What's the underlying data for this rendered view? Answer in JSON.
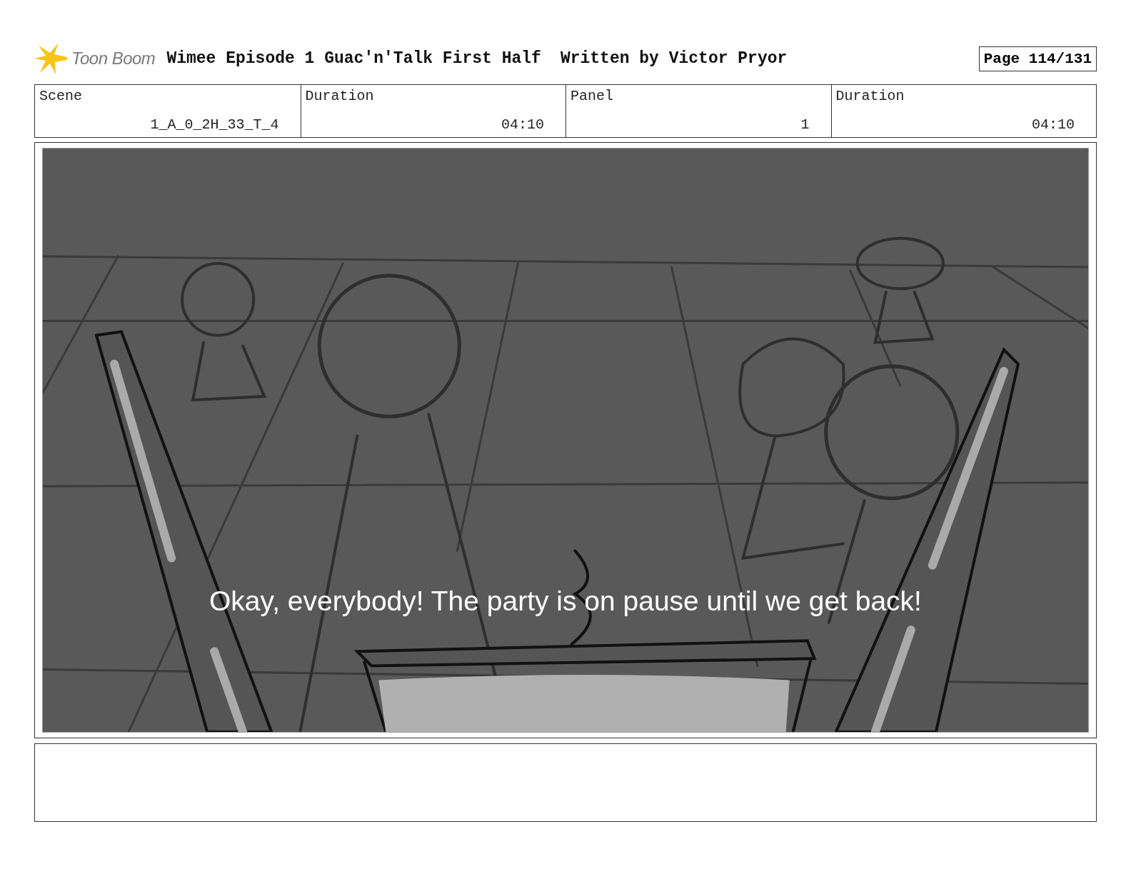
{
  "header": {
    "logo": "Toon Boom",
    "title": "Wimee Episode 1 Guac'n'Talk First Half",
    "author": "Written by Victor Pryor",
    "page": "Page 114/131"
  },
  "info": [
    {
      "label": "Scene",
      "value": "1_A_0_2H_33_T_4"
    },
    {
      "label": "Duration",
      "value": "04:10"
    },
    {
      "label": "Panel",
      "value": "1"
    },
    {
      "label": "Duration",
      "value": "04:10"
    }
  ],
  "panel": {
    "caption": "Okay, everybody! The party is on pause until we get back!"
  }
}
